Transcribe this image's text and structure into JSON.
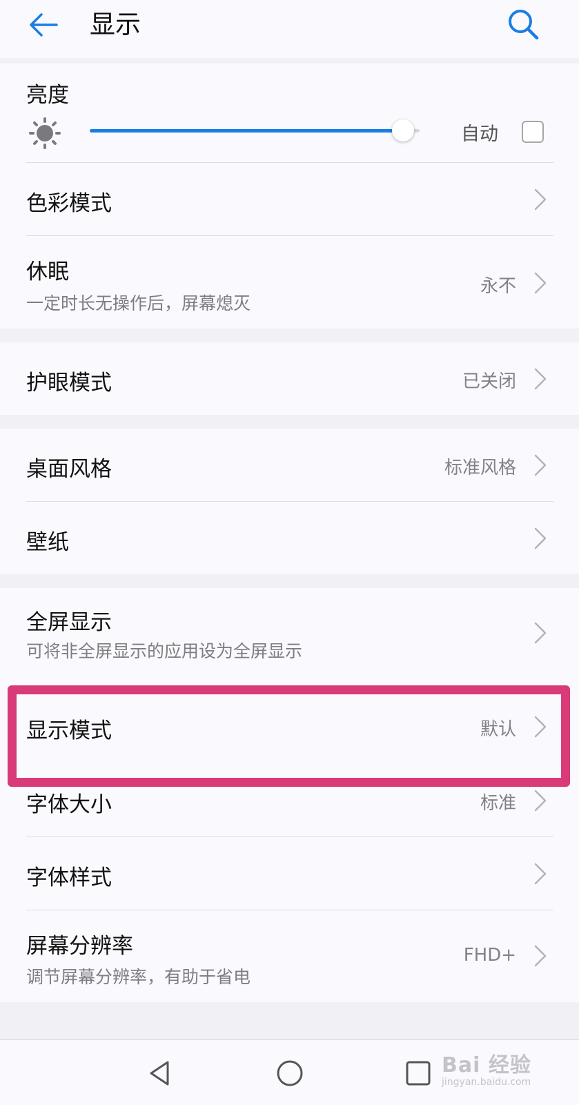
{
  "header": {
    "title": "显示",
    "back_icon": "arrow-left-icon",
    "search_icon": "search-icon",
    "accent_color": "#1a7ee4"
  },
  "brightness": {
    "title": "亮度",
    "level": 0.95,
    "auto_label": "自动",
    "auto_checked": false
  },
  "rows": {
    "color_mode": {
      "title": "色彩模式",
      "value": ""
    },
    "sleep": {
      "title": "休眠",
      "subtitle": "一定时长无操作后，屏幕熄灭",
      "value": "永不"
    },
    "eye_comfort": {
      "title": "护眼模式",
      "value": "已关闭"
    },
    "home_style": {
      "title": "桌面风格",
      "value": "标准风格"
    },
    "wallpaper": {
      "title": "壁纸",
      "value": ""
    },
    "full_screen": {
      "title": "全屏显示",
      "subtitle": "可将非全屏显示的应用设为全屏显示",
      "value": ""
    },
    "display_mode": {
      "title": "显示模式",
      "value": "默认"
    },
    "font_size": {
      "title": "字体大小",
      "value": "标准"
    },
    "font_style": {
      "title": "字体样式",
      "value": ""
    },
    "resolution": {
      "title": "屏幕分辨率",
      "subtitle": "调节屏幕分辨率，有助于省电",
      "value": "FHD+"
    }
  },
  "highlight_color": "#d93b78",
  "watermark": {
    "main": "Bai 经验",
    "sub": "jingyan.baidu.com"
  }
}
